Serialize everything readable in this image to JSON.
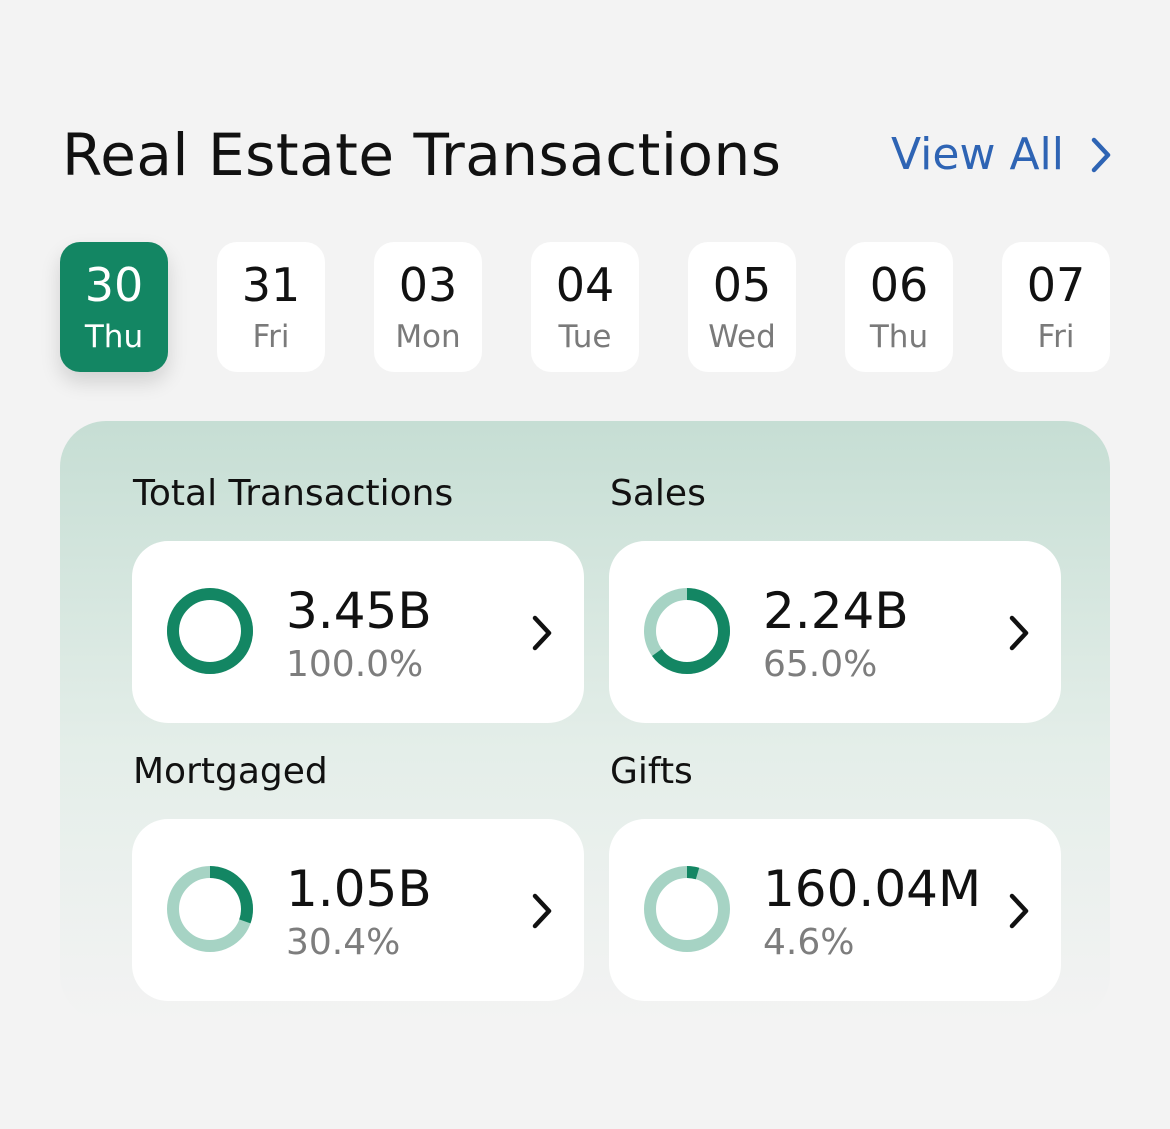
{
  "header": {
    "title": "Real Estate Transactions",
    "view_all_label": "View All"
  },
  "dates": [
    {
      "num": "30",
      "day": "Thu",
      "selected": true
    },
    {
      "num": "31",
      "day": "Fri",
      "selected": false
    },
    {
      "num": "03",
      "day": "Mon",
      "selected": false
    },
    {
      "num": "04",
      "day": "Tue",
      "selected": false
    },
    {
      "num": "05",
      "day": "Wed",
      "selected": false
    },
    {
      "num": "06",
      "day": "Thu",
      "selected": false
    },
    {
      "num": "07",
      "day": "Fri",
      "selected": false
    }
  ],
  "stats": [
    {
      "label": "Total Transactions",
      "value": "3.45B",
      "percent": "100.0%",
      "fraction": 1.0
    },
    {
      "label": "Sales",
      "value": "2.24B",
      "percent": "65.0%",
      "fraction": 0.65
    },
    {
      "label": "Mortgaged",
      "value": "1.05B",
      "percent": "30.4%",
      "fraction": 0.304
    },
    {
      "label": "Gifts",
      "value": "160.04M",
      "percent": "4.6%",
      "fraction": 0.046
    }
  ],
  "colors": {
    "accent": "#138663",
    "accent_light": "#a6d3c4",
    "link": "#2e64b4",
    "background": "#f3f3f3"
  },
  "icons": {
    "view_all": "chevron-right-icon",
    "card": "chevron-right-icon",
    "stat": "donut-progress-icon"
  }
}
